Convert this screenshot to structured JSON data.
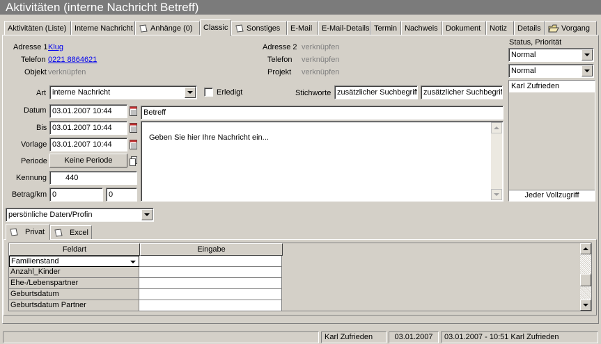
{
  "window": {
    "title": "Aktivitäten (interne Nachricht Betreff)"
  },
  "tabs": [
    {
      "label": "Aktivitäten (Liste)"
    },
    {
      "label": "Interne Nachricht"
    },
    {
      "label": "Anhänge (0)",
      "icon": "attachment-icon"
    },
    {
      "label": "Classic",
      "active": true
    },
    {
      "label": "Sonstiges",
      "icon": "note-icon"
    },
    {
      "label": "E-Mail"
    },
    {
      "label": "E-Mail-Details"
    },
    {
      "label": "Termin"
    },
    {
      "label": "Nachweis"
    },
    {
      "label": "Dokument"
    },
    {
      "label": "Notiz"
    },
    {
      "label": "Details"
    },
    {
      "label": "Vorgang",
      "icon": "folder-icon"
    }
  ],
  "address1": {
    "label": "Adresse 1",
    "value": "Klug"
  },
  "phone1": {
    "label": "Telefon",
    "value": "0221 8864621"
  },
  "object": {
    "label": "Objekt",
    "value": "verknüpfen"
  },
  "address2": {
    "label": "Adresse 2",
    "value": "verknüpfen"
  },
  "phone2": {
    "label": "Telefon",
    "value": "verknüpfen"
  },
  "project": {
    "label": "Projekt",
    "value": "verknüpfen"
  },
  "status": {
    "label": "Status, Priorität",
    "status_value": "Normal",
    "priority_value": "Normal",
    "users": [
      "Karl Zufrieden"
    ],
    "access_label": "Jeder Vollzugriff"
  },
  "art": {
    "label": "Art",
    "value": "interne Nachricht"
  },
  "done": {
    "label": "Erledigt",
    "checked": false
  },
  "keywords": {
    "label": "Stichworte",
    "value1": "zusätzlicher Suchbegriff",
    "value2": "zusätzlicher Suchbegriff"
  },
  "date": {
    "label": "Datum",
    "value": "03.01.2007 10:44"
  },
  "until": {
    "label": "Bis",
    "value": "03.01.2007 10:44"
  },
  "template": {
    "label": "Vorlage",
    "value": "03.01.2007 10:44"
  },
  "period": {
    "label": "Periode",
    "button": "Keine Periode"
  },
  "code": {
    "label": "Kennung",
    "value": "440"
  },
  "amount": {
    "label": "Betrag/km",
    "value1": "0",
    "value2": "0"
  },
  "subject": {
    "value": "Betreff"
  },
  "message": {
    "placeholder": "Geben Sie hier Ihre Nachricht ein..."
  },
  "profile": {
    "value": "persönliche Daten/Profin"
  },
  "subtabs": [
    {
      "label": "Privat",
      "icon": "note-icon",
      "active": true
    },
    {
      "label": "Excel",
      "icon": "note-icon"
    }
  ],
  "grid": {
    "headers": [
      "Feldart",
      "Eingabe"
    ],
    "rows": [
      "Familienstand",
      "Anzahl_Kinder",
      "Ehe-/Lebenspartner",
      "Geburtsdatum",
      "Geburtsdatum Partner"
    ]
  },
  "statusbar": {
    "user": "Karl Zufrieden",
    "date": "03.01.2007",
    "modified": "03.01.2007 - 10:51 Karl Zufrieden"
  }
}
